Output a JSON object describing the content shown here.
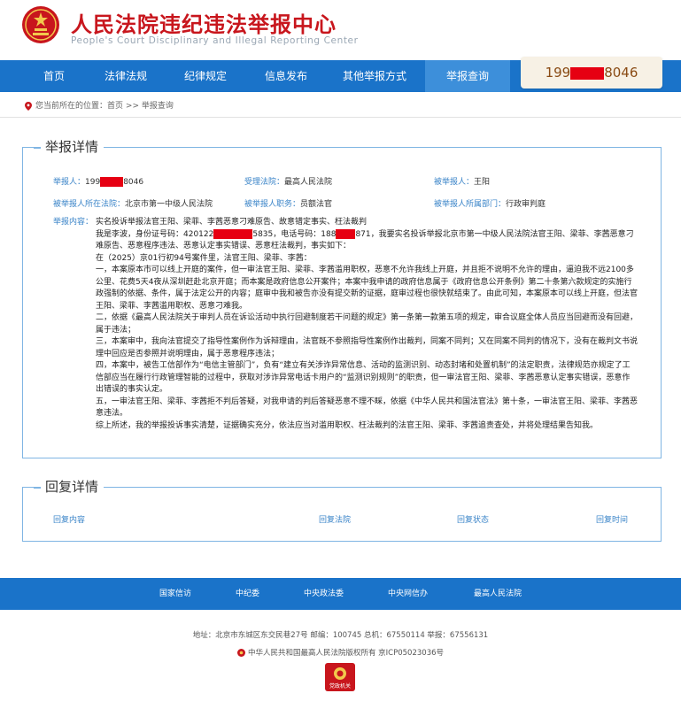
{
  "header": {
    "title": "人民法院违纪违法举报中心",
    "subtitle": "People's Court Disciplinary and Illegal Reporting Center",
    "hotline_prefix": "199",
    "hotline_suffix": "8046"
  },
  "nav": {
    "items": [
      {
        "label": "首页"
      },
      {
        "label": "法律法规"
      },
      {
        "label": "纪律规定"
      },
      {
        "label": "信息发布"
      },
      {
        "label": "其他举报方式"
      },
      {
        "label": "举报查询"
      }
    ]
  },
  "breadcrumb": {
    "prefix": "您当前所在的位置：",
    "home": "首页",
    "sep": ">>",
    "current": "举报查询"
  },
  "detail": {
    "title": "举报详情",
    "reporter_label": "举报人：",
    "reporter_prefix": "199",
    "reporter_suffix": "8046",
    "court_label": "受理法院：",
    "court_value": "最高人民法院",
    "reported_label": "被举报人：",
    "reported_value": "王阳",
    "reported_court_label": "被举报人所在法院：",
    "reported_court_value": "北京市第一中级人民法院",
    "position_label": "被举报人职务：",
    "position_value": "员额法官",
    "dept_label": "被举报人所属部门：",
    "dept_value": "行政审判庭",
    "content_label": "举报内容：",
    "content": {
      "line1": "实名投诉举报法官王阳、梁菲、李茜恶意刁难原告、故意错定事实、枉法裁判",
      "line2_a": "我是李波，身份证号码：420122",
      "line2_b": "5835，电话号码：188",
      "line2_c": "871，我要实名投诉举报北京市第一中级人民法院法官王阳、梁菲、李茜恶意刁难原告、恶意程序违法、恶意认定事实错误、恶意枉法裁判，事实如下：",
      "p_case": "在（2025）京01行初94号案件里，法官王阳、梁菲、李茜：",
      "p1": "一，本案原本市可以线上开庭的案件，但一审法官王阳、梁菲、李茜滥用职权，恶意不允许我线上开庭，并且拒不说明不允许的理由，逼迫我不远2100多公里、花费5天4夜从深圳赶赴北京开庭；而本案是政府信息公开案件；本案中我申请的政府信息属于《政府信息公开条例》第二十条第六款规定的实施行政强制的依据、条件，属于法定公开的内容；庭审中我和被告亦没有提交新的证据，庭审过程也很快就结束了。由此可知，本案原本可以线上开庭，但法官王阳、梁菲、李茜滥用职权、恶意刁难我。",
      "p2": "二，依据《最高人民法院关于审判人员在诉讼活动中执行回避制度若干问题的规定》第一条第一款第五项的规定，审合议庭全体人员应当回避而没有回避，属于违法；",
      "p3": "三，本案审中，我向法官提交了指导性案例作为诉辩理由，法官既不参照指导性案例作出裁判，同案不同判；又在同案不同判的情况下，没有在裁判文书说理中回应是否参照并说明理由，属于恶意程序违法；",
      "p4": "四，本案中，被告工信部作为“电信主管部门”，负有“建立有关涉诈异常信息、活动的监测识别、动态封堵和处置机制”的法定职责，法律规范亦规定了工信部应当在履行行政管理智能的过程中，获取对涉诈异常电话卡用户的“监测识别规则”的职责，但一审法官王阳、梁菲、李茜恶意认定事实错误，恶意作出错误的事实认定。",
      "p5": "五，一审法官王阳、梁菲、李茜拒不判后答疑，对我申请的判后答疑恶意不理不睬，依据《中华人民共和国法官法》第十条，一审法官王阳、梁菲、李茜恶意违法。",
      "p6": "综上所述，我的举报投诉事实清楚，证据确实充分，依法应当对滥用职权、枉法裁判的法官王阳、梁菲、李茜追责查处，并将处理结果告知我。"
    }
  },
  "reply": {
    "title": "回复详情",
    "headers": [
      "回复内容",
      "回复法院",
      "回复状态",
      "回复时间"
    ]
  },
  "footer": {
    "links": [
      "国家信访",
      "中纪委",
      "中央政法委",
      "中央网信办",
      "最高人民法院"
    ],
    "address": "地址：北京市东城区东交民巷27号  邮编：100745  总机：67550114  举报：67556131",
    "copyright": "中华人民共和国最高人民法院版权所有  京ICP05023036号",
    "badge_text": "党政机关"
  },
  "colors": {
    "brand_red": "#c8161d",
    "nav_blue": "#1a73c9",
    "label_blue": "#3a84c8",
    "redaction": "#e60012"
  }
}
